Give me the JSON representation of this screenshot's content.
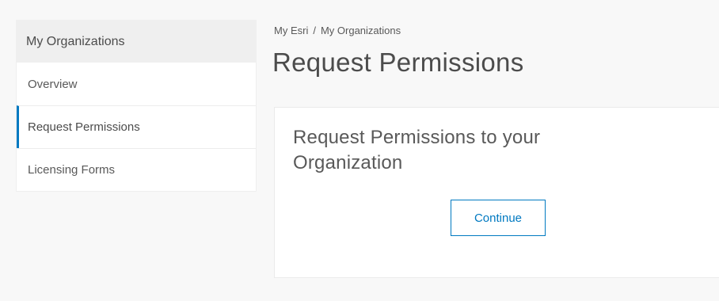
{
  "sidebar": {
    "header": "My Organizations",
    "items": [
      {
        "label": "Overview",
        "active": false
      },
      {
        "label": "Request Permissions",
        "active": true
      },
      {
        "label": "Licensing Forms",
        "active": false
      }
    ],
    "active_indicator_color": "#0079c1"
  },
  "breadcrumb": {
    "items": [
      "My Esri",
      "My Organizations"
    ],
    "separator": "/"
  },
  "page": {
    "title": "Request Permissions"
  },
  "card": {
    "heading": "Request Permissions to your Organization",
    "continue_label": "Continue",
    "accent_color": "#0079c1"
  }
}
